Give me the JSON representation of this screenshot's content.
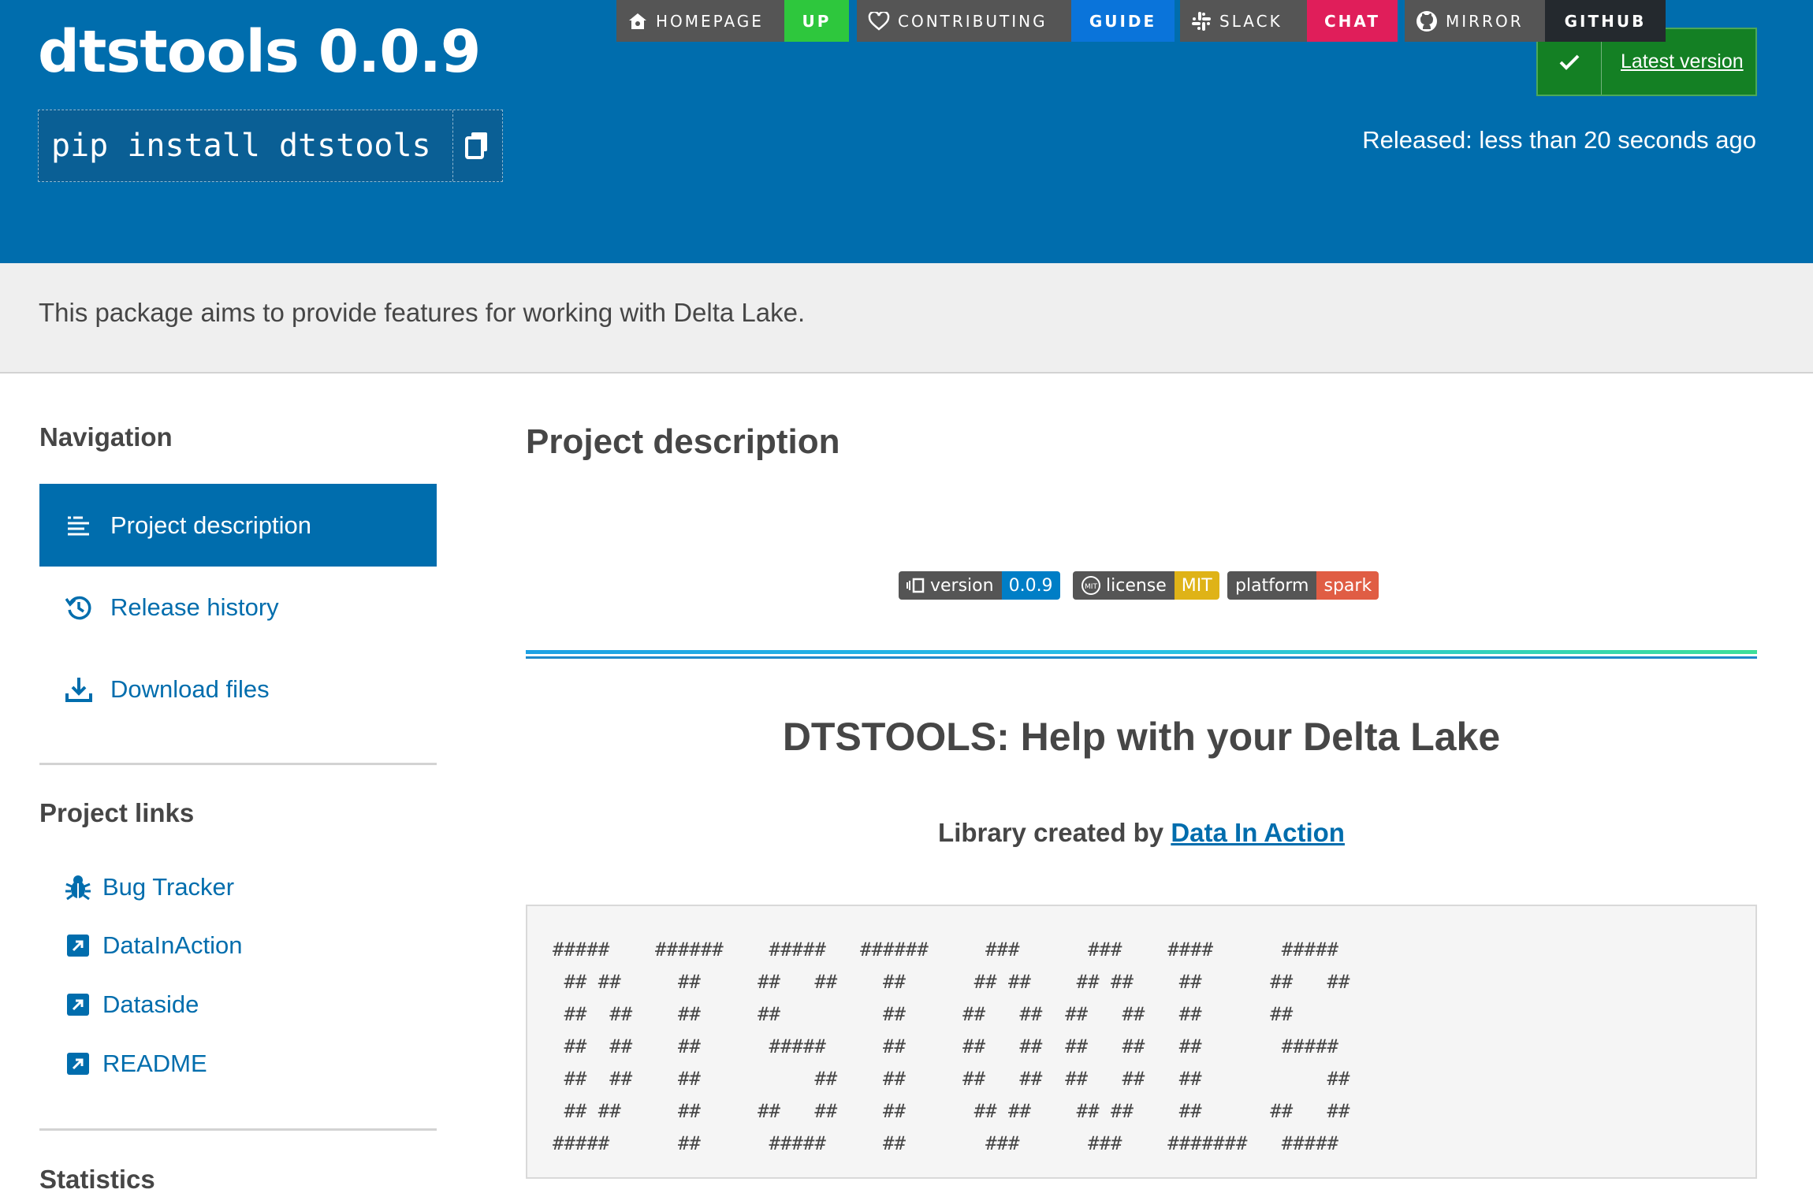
{
  "header": {
    "title": "dtstools 0.0.9",
    "pip_command": "pip install dtstools",
    "latest_version_label": "Latest version",
    "released": "Released: less than 20 seconds ago",
    "colors": {
      "background": "#006dad",
      "latest_bg": "#148024"
    }
  },
  "summary": "This package aims to provide features for working with Delta Lake.",
  "sidebar": {
    "navigation_heading": "Navigation",
    "nav": [
      {
        "label": "Project description",
        "icon": "align-left-icon",
        "active": true
      },
      {
        "label": "Release history",
        "icon": "history-icon",
        "active": false
      },
      {
        "label": "Download files",
        "icon": "download-icon",
        "active": false
      }
    ],
    "project_links_heading": "Project links",
    "links": [
      {
        "label": "Bug Tracker",
        "icon": "bug-icon"
      },
      {
        "label": "DataInAction",
        "icon": "external-link-icon"
      },
      {
        "label": "Dataside",
        "icon": "external-link-icon"
      },
      {
        "label": "README",
        "icon": "external-link-icon"
      }
    ],
    "statistics_heading": "Statistics"
  },
  "main": {
    "heading": "Project description",
    "badges": [
      {
        "left": "HOMEPAGE",
        "right": "UP",
        "icon": "home-icon",
        "color": "#2ec73d"
      },
      {
        "left": "CONTRIBUTING",
        "right": "GUIDE",
        "icon": "heart-icon",
        "color": "#0a74da"
      },
      {
        "left": "SLACK",
        "right": "CHAT",
        "icon": "slack-icon",
        "color": "#e01e5a"
      },
      {
        "left": "MIRROR",
        "right": "GITHUB",
        "icon": "github-icon",
        "color": "#24292e"
      }
    ],
    "small_badges": [
      {
        "left": "version",
        "right": "0.0.9",
        "icon": "version-icon",
        "color": "#007ec6"
      },
      {
        "left": "license",
        "right": "MIT",
        "icon": "mit-icon",
        "color": "#dfb317"
      },
      {
        "left": "platform",
        "right": "spark",
        "icon": "",
        "color": "#e05d44"
      }
    ],
    "readme_title": "DTSTOOLS: Help with your Delta Lake",
    "library_prefix": "Library created by",
    "library_link": "Data In Action",
    "ascii_art": "#####    ######    #####   ######     ###      ###    ####      #####\n ## ##     ##     ##   ##    ##      ## ##    ## ##    ##      ##   ##\n ##  ##    ##     ##         ##     ##   ##  ##   ##   ##      ##\n ##  ##    ##      #####     ##     ##   ##  ##   ##   ##       #####\n ##  ##    ##          ##    ##     ##   ##  ##   ##   ##           ##\n ## ##     ##     ##   ##    ##      ## ##    ## ##    ##      ##   ##\n#####      ##      #####     ##       ###      ###    #######   #####"
  }
}
